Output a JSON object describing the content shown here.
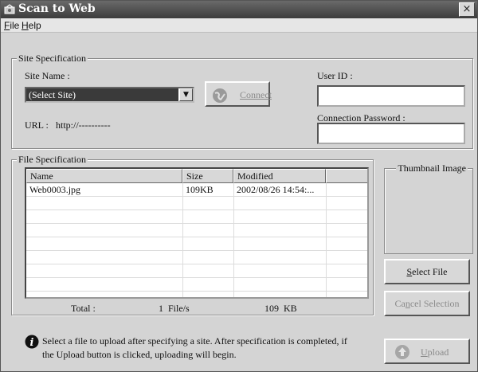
{
  "window": {
    "title": "Scan to Web",
    "close_glyph": "×"
  },
  "menu": [
    {
      "accel": "F",
      "rest": "ile"
    },
    {
      "accel": "H",
      "rest": "elp"
    }
  ],
  "site_spec": {
    "group_title": "Site Specification",
    "site_name_label": "Site Name :",
    "site_name_value": "(Select Site)",
    "connect_label": "Connect",
    "url_label": "URL :",
    "url_value": "http://----------",
    "user_id_label": "User ID :",
    "user_id_value": "",
    "password_label": "Connection Password :",
    "password_value": ""
  },
  "file_spec": {
    "group_title": "File Specification",
    "columns": [
      "Name",
      "Size",
      "Modified",
      ""
    ],
    "rows": [
      {
        "name": "Web0003.jpg",
        "size": "109KB",
        "modified": "2002/08/26 14:54:..."
      }
    ],
    "total_label": "Total :",
    "total_count": "1",
    "total_unit": "File/s",
    "total_size": "109  KB"
  },
  "thumbnail": {
    "title": "Thumbnail Image"
  },
  "buttons": {
    "select_file": {
      "accel": "S",
      "rest": "elect File"
    },
    "cancel_selection": {
      "pre": "Ca",
      "accel": "n",
      "rest": "cel Selection"
    },
    "upload": {
      "accel": "U",
      "rest": "pload"
    }
  },
  "info": {
    "icon": "info-icon",
    "message": "Select a file to upload after specifying a site. After specification is completed, if the Upload button is clicked, uploading will begin."
  }
}
